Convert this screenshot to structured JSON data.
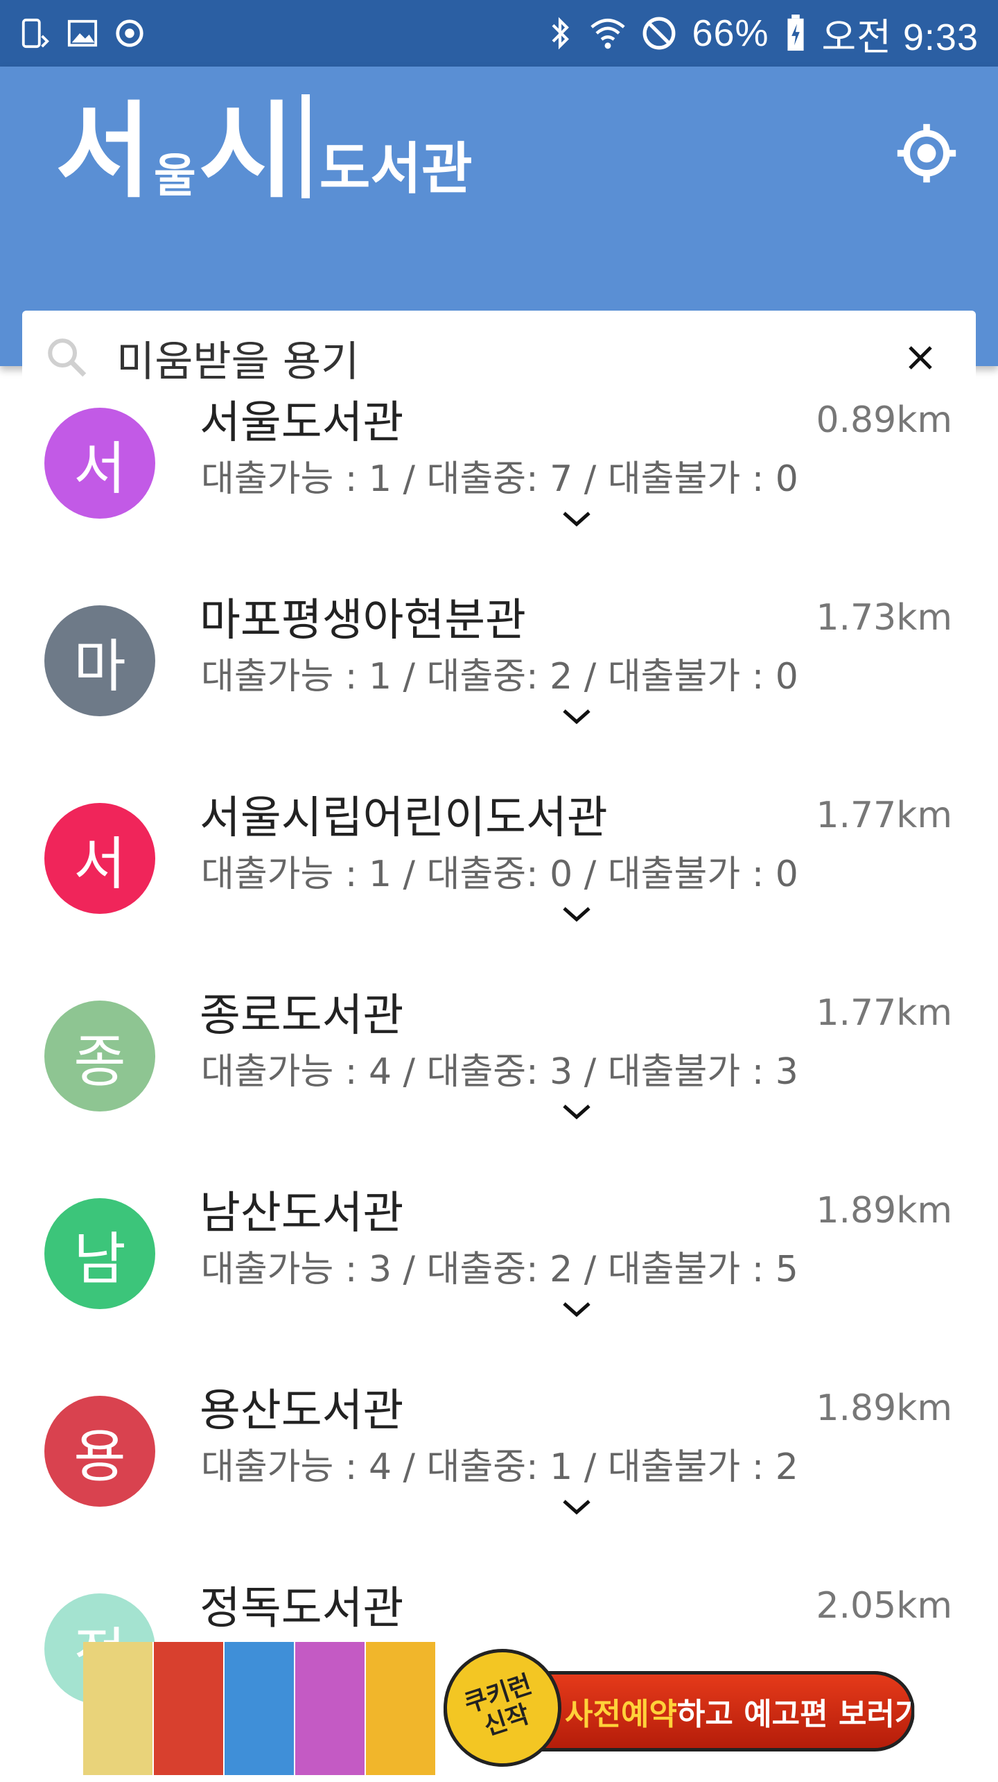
{
  "status_bar": {
    "battery": "66%",
    "time": "오전 9:33",
    "icons": [
      "screen-rotate-icon",
      "image-icon",
      "sync-icon",
      "bluetooth-icon",
      "wifi-icon",
      "do-not-disturb-icon",
      "battery-charging-icon"
    ]
  },
  "header": {
    "logo_seo": "서",
    "logo_ul": "울",
    "logo_si": "시",
    "logo_sub": "도서관",
    "locate_icon": "my-location-icon"
  },
  "search": {
    "value": "미움받을 용기",
    "icon": "search-icon",
    "clear_icon": "close-icon"
  },
  "libraries": [
    {
      "initial": "서",
      "name": "서울도서관",
      "counts": "대출가능 : 1 / 대출중: 7 / 대출불가 : 0",
      "distance": "0.89km",
      "color": "#c25ae6"
    },
    {
      "initial": "마",
      "name": "마포평생아현분관",
      "counts": "대출가능 : 1 / 대출중: 2 / 대출불가 : 0",
      "distance": "1.73km",
      "color": "#6e7a88"
    },
    {
      "initial": "서",
      "name": "서울시립어린이도서관",
      "counts": "대출가능 : 1 / 대출중: 0 / 대출불가 : 0",
      "distance": "1.77km",
      "color": "#f0255a"
    },
    {
      "initial": "종",
      "name": "종로도서관",
      "counts": "대출가능 : 4 / 대출중: 3 / 대출불가 : 3",
      "distance": "1.77km",
      "color": "#8ec592"
    },
    {
      "initial": "남",
      "name": "남산도서관",
      "counts": "대출가능 : 3 / 대출중: 2 / 대출불가 : 5",
      "distance": "1.89km",
      "color": "#3cc57a"
    },
    {
      "initial": "용",
      "name": "용산도서관",
      "counts": "대출가능 : 4 / 대출중: 1 / 대출불가 : 2",
      "distance": "1.89km",
      "color": "#d9424f"
    },
    {
      "initial": "정",
      "name": "정독도서관",
      "counts": "",
      "distance": "2.05km",
      "color": "#a4e3d0"
    }
  ],
  "ad": {
    "seal_line1": "쿠키런",
    "seal_line2": "신작",
    "cta_highlight": "사전예약",
    "cta_rest": "하고 예고편 보러가기"
  }
}
